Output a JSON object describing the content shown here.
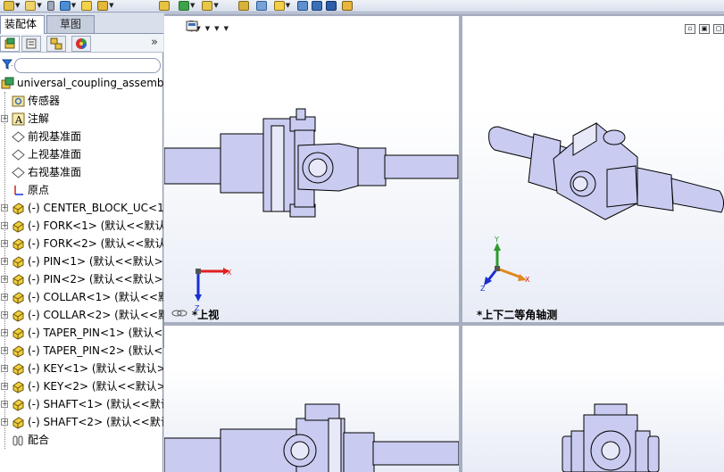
{
  "feature_manager": {
    "tabs": [
      {
        "label": "装配体",
        "active": true
      },
      {
        "label": "草图",
        "active": false
      }
    ],
    "collapse_label": "»",
    "tree": [
      {
        "label": "universal_coupling_assembly",
        "icon": "assembly-icon",
        "expandable": false,
        "indent": 0
      },
      {
        "label": "传感器",
        "icon": "sensor-icon",
        "expandable": false,
        "indent": 1
      },
      {
        "label": "注解",
        "icon": "annotation-icon",
        "expandable": true,
        "indent": 1
      },
      {
        "label": "前视基准面",
        "icon": "plane-icon",
        "expandable": false,
        "indent": 1
      },
      {
        "label": "上视基准面",
        "icon": "plane-icon",
        "expandable": false,
        "indent": 1
      },
      {
        "label": "右视基准面",
        "icon": "plane-icon",
        "expandable": false,
        "indent": 1
      },
      {
        "label": "原点",
        "icon": "origin-icon",
        "expandable": false,
        "indent": 1
      },
      {
        "label": "(-) CENTER_BLOCK_UC<1",
        "icon": "part-icon",
        "expandable": true,
        "indent": 1
      },
      {
        "label": "(-) FORK<1> (默认<<默认",
        "icon": "part-icon",
        "expandable": true,
        "indent": 1
      },
      {
        "label": "(-) FORK<2> (默认<<默认",
        "icon": "part-icon",
        "expandable": true,
        "indent": 1
      },
      {
        "label": "(-) PIN<1> (默认<<默认>",
        "icon": "part-icon",
        "expandable": true,
        "indent": 1
      },
      {
        "label": "(-) PIN<2> (默认<<默认>",
        "icon": "part-icon",
        "expandable": true,
        "indent": 1
      },
      {
        "label": "(-) COLLAR<1> (默认<<默",
        "icon": "part-icon",
        "expandable": true,
        "indent": 1
      },
      {
        "label": "(-) COLLAR<2> (默认<<默",
        "icon": "part-icon",
        "expandable": true,
        "indent": 1
      },
      {
        "label": "(-) TAPER_PIN<1> (默认<",
        "icon": "part-icon",
        "expandable": true,
        "indent": 1
      },
      {
        "label": "(-) TAPER_PIN<2> (默认<",
        "icon": "part-icon",
        "expandable": true,
        "indent": 1
      },
      {
        "label": "(-) KEY<1> (默认<<默认>",
        "icon": "part-icon",
        "expandable": true,
        "indent": 1
      },
      {
        "label": "(-) KEY<2> (默认<<默认>",
        "icon": "part-icon",
        "expandable": true,
        "indent": 1
      },
      {
        "label": "(-) SHAFT<1> (默认<<默认",
        "icon": "part-icon",
        "expandable": true,
        "indent": 1
      },
      {
        "label": "(-) SHAFT<2> (默认<<默认",
        "icon": "part-icon",
        "expandable": true,
        "indent": 1
      },
      {
        "label": "配合",
        "icon": "mates-icon",
        "expandable": false,
        "indent": 1
      }
    ]
  },
  "viewports": {
    "top_left": {
      "label": "*上视",
      "triad": [
        "X",
        "Z"
      ]
    },
    "top_right": {
      "label": "*上下二等角轴测",
      "triad": [
        "Y",
        "X",
        "Z"
      ]
    },
    "bottom_left": {
      "label": ""
    },
    "bottom_right": {
      "label": ""
    }
  },
  "colors": {
    "part_fill": "#c9cbf0",
    "part_stroke": "#000000",
    "axis_x": "#e02020",
    "axis_y": "#2c9a2c",
    "axis_z": "#1a2fd0"
  }
}
